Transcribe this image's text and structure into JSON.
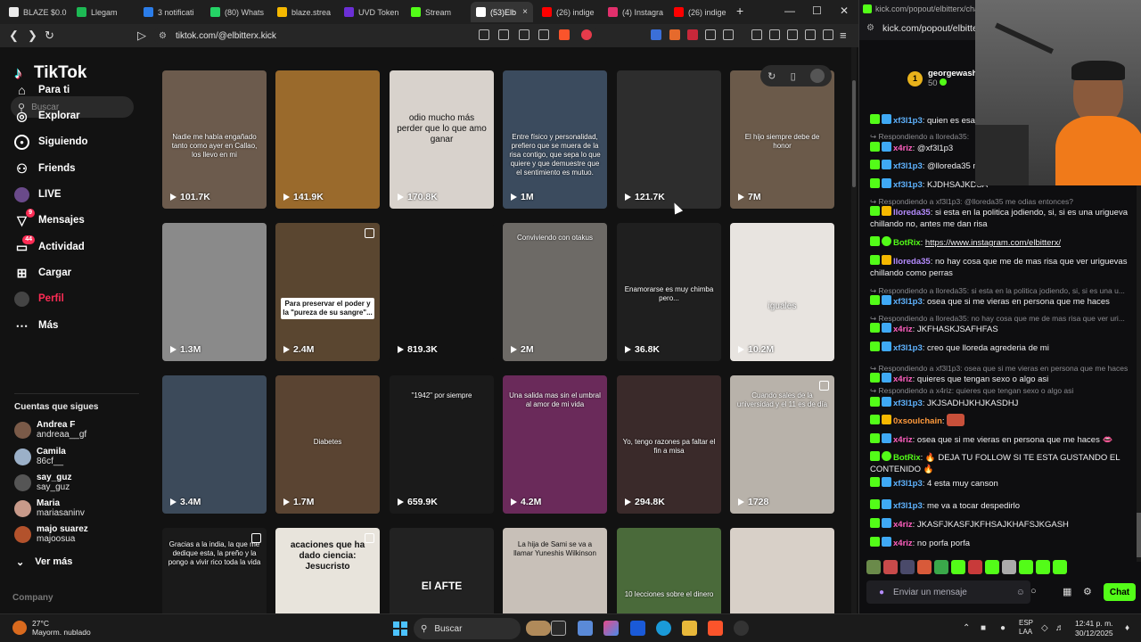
{
  "browser": {
    "tabs": [
      {
        "label": "BLAZE $0.0",
        "color": "#eaeaea"
      },
      {
        "label": "Llegam",
        "color": "#1db954"
      },
      {
        "label": "3 notificati",
        "color": "#2b7de9"
      },
      {
        "label": "(80) Whats",
        "color": "#25d366"
      },
      {
        "label": "blaze.strea",
        "color": "#f5b800"
      },
      {
        "label": "UVD Token",
        "color": "#6b2fd6"
      },
      {
        "label": "Stream",
        "color": "#53fc18"
      },
      {
        "label": "(53)Elb",
        "color": "#ffffff"
      },
      {
        "label": "(26) indige",
        "color": "#ff0000"
      },
      {
        "label": "(4) Instagra",
        "color": "#e1306c"
      },
      {
        "label": "(26) indige",
        "color": "#ff0000"
      }
    ],
    "url": "tiktok.com/@elbitterx.kick",
    "new_tab": "+",
    "close_tab": "×"
  },
  "tiktok": {
    "logo": "TikTok",
    "search_placeholder": "Buscar",
    "nav": [
      {
        "label": "Para ti",
        "icon": "home-icon"
      },
      {
        "label": "Explorar",
        "icon": "compass-icon"
      },
      {
        "label": "Siguiendo",
        "icon": "following-icon"
      },
      {
        "label": "Friends",
        "icon": "friends-icon"
      },
      {
        "label": "LIVE",
        "icon": "live-icon"
      },
      {
        "label": "Mensajes",
        "icon": "messages-icon",
        "badge": "9"
      },
      {
        "label": "Actividad",
        "icon": "activity-icon",
        "badge": "44"
      },
      {
        "label": "Cargar",
        "icon": "upload-icon"
      },
      {
        "label": "Perfil",
        "icon": "profile-icon"
      },
      {
        "label": "Más",
        "icon": "more-icon"
      }
    ],
    "following_header": "Cuentas que sigues",
    "following": [
      {
        "name": "Andrea F",
        "handle": "andreaa__gf",
        "color": "#7a5a48"
      },
      {
        "name": "Camila",
        "handle": "86cf__",
        "color": "#9bb0c8"
      },
      {
        "name": "say_guz",
        "handle": "say_guz",
        "color": "#555"
      },
      {
        "name": "Maria",
        "handle": "mariasaninv",
        "color": "#c89a8a"
      },
      {
        "name": "majo suarez",
        "handle": "majoosua",
        "color": "#b3522c"
      }
    ],
    "see_more": "Ver más",
    "company": "Company",
    "videos": [
      {
        "views": "101.7K",
        "caption": "Nadie me había engañado tanto como ayer en Callao, los llevo en mi",
        "bg": "#6c5b4d"
      },
      {
        "views": "141.9K",
        "caption": "",
        "bg": "#9a6a2c"
      },
      {
        "views": "170.8K",
        "caption": "odio mucho más perder que lo que amo ganar",
        "bg": "#d8d2cc"
      },
      {
        "views": "1M",
        "caption": "Entre físico y personalidad, prefiero que se muera de la risa contigo, que sepa lo que quiere y que demuestre que el sentimiento es mutuo.",
        "bg": "#3b4b5e"
      },
      {
        "views": "121.7K",
        "caption": "",
        "bg": "#2d2d2d"
      },
      {
        "views": "7M",
        "caption": "El hijo siempre debe de honor",
        "bg": "#6b5a4a"
      },
      {
        "views": "1.3M",
        "caption": "",
        "bg": "#8a8a8a"
      },
      {
        "views": "2.4M",
        "caption": "Para preservar el poder y la \"pureza de su sangre\"...",
        "bg": "#5a4630"
      },
      {
        "views": "819.3K",
        "caption": "",
        "bg": "#121212"
      },
      {
        "views": "2M",
        "caption": "Conviviendo con otakus",
        "bg": "#6d6a66"
      },
      {
        "views": "36.8K",
        "caption": "Enamorarse es muy chimba pero...",
        "bg": "#1f1f1f"
      },
      {
        "views": "10.2M",
        "caption": "iguales",
        "bg": "#e8e4e0"
      },
      {
        "views": "3.4M",
        "caption": "",
        "bg": "#3c4a5a"
      },
      {
        "views": "1.7M",
        "caption": "Diabetes",
        "bg": "#5a4432"
      },
      {
        "views": "659.9K",
        "caption": "\"1942\" por siempre",
        "bg": "#1a1a1a"
      },
      {
        "views": "4.2M",
        "caption": "Una salida mas sin el umbral al amor de mi vida",
        "bg": "#6a2a5a"
      },
      {
        "views": "294.8K",
        "caption": "Yo, tengo razones pa faltar el fin a misa",
        "bg": "#3a2a2a"
      },
      {
        "views": "1728",
        "caption": "Cuando sales de la universidad y el 11 es de día",
        "bg": "#b8b2aa"
      },
      {
        "views": "",
        "caption": "Gracias a la india, la que me dedique esta, la preño y la pongo a vivir rico toda la vida",
        "bg": "#1a1a1a"
      },
      {
        "views": "",
        "caption": "acaciones que ha dado ciencia: Jesucristo",
        "bg": "#e8e4dc"
      },
      {
        "views": "",
        "caption": "El AFTE",
        "bg": "#222"
      },
      {
        "views": "",
        "caption": "La hija de Sami se va a llamar Yuneshis Wilkinson",
        "bg": "#c8c0b8"
      },
      {
        "views": "",
        "caption": "10 lecciones sobre el dinero",
        "bg": "#4a6a3a"
      },
      {
        "views": "",
        "caption": "",
        "bg": "#d8d0c8"
      }
    ]
  },
  "chat": {
    "url_top": "kick.com/popout/elbitterx/chat",
    "url": "kick.com/popout/elbitten",
    "leader": {
      "name": "georgewash",
      "rank": "1",
      "points": "50"
    },
    "messages": [
      {
        "type": "msg",
        "user": "xf3l1p3",
        "ucolor": "#5fb3ff",
        "badge": "mod",
        "text": ": quien es esa beb"
      },
      {
        "type": "reply",
        "text": "Respondiendo a lloreda35:"
      },
      {
        "type": "msg",
        "user": "x4riz",
        "ucolor": "#ff5fbf",
        "badge": "mod",
        "text": ": @xf3l1p3"
      },
      {
        "type": "msg",
        "user": "xf3l1p3",
        "ucolor": "#5fb3ff",
        "badge": "mod",
        "text": ": @lloreda35 me o"
      },
      {
        "type": "msg",
        "user": "xf3l1p3",
        "ucolor": "#5fb3ff",
        "badge": "mod",
        "text": ": KJDHSAJKDSA"
      },
      {
        "type": "reply",
        "text": "Respondiendo a xf3l1p3: @lloreda35 me odias entonces?"
      },
      {
        "type": "msg",
        "user": "lloreda35",
        "ucolor": "#b58cff",
        "badge": "crown",
        "text": ": si esta en la politica jodiendo, si, si es una urigueva chillando no, antes me dan risa"
      },
      {
        "type": "msg",
        "user": "BotRix",
        "ucolor": "#53fc18",
        "badge": "verif",
        "text": ": ",
        "link": "https://www.instagram.com/elbitterx/"
      },
      {
        "type": "msg",
        "user": "lloreda35",
        "ucolor": "#b58cff",
        "badge": "crown",
        "text": ": no hay cosa que me de mas risa que ver uriguevas chillando como perras"
      },
      {
        "type": "reply",
        "text": "Respondiendo a lloreda35: si esta en la politica jodiendo, si, si es una u..."
      },
      {
        "type": "msg",
        "user": "xf3l1p3",
        "ucolor": "#5fb3ff",
        "badge": "mod",
        "text": ": osea que si me vieras en persona que me haces"
      },
      {
        "type": "reply",
        "text": "Respondiendo a lloreda35: no hay cosa que me de mas risa que ver uri..."
      },
      {
        "type": "msg",
        "user": "x4riz",
        "ucolor": "#ff5fbf",
        "badge": "mod",
        "text": ": JKFHASKJSAFHFAS"
      },
      {
        "type": "msg",
        "user": "xf3l1p3",
        "ucolor": "#5fb3ff",
        "badge": "mod",
        "text": ": creo que lloreda agrederia de mi"
      },
      {
        "type": "reply",
        "text": "Respondiendo a xf3l1p3: osea que si me vieras en persona que me haces"
      },
      {
        "type": "msg",
        "user": "x4riz",
        "ucolor": "#ff5fbf",
        "badge": "mod",
        "text": ": quieres que tengan sexo o algo asi"
      },
      {
        "type": "reply",
        "text": "Respondiendo a x4riz: quieres que tengan sexo o algo asi"
      },
      {
        "type": "msg",
        "user": "xf3l1p3",
        "ucolor": "#5fb3ff",
        "badge": "mod",
        "text": ": JKJSADHJKHJKASDHJ"
      },
      {
        "type": "msg",
        "user": "0xsoulchain",
        "ucolor": "#ff9a3c",
        "badge": "crown",
        "text": ": ",
        "emote": true
      },
      {
        "type": "msg",
        "user": "x4riz",
        "ucolor": "#ff5fbf",
        "badge": "mod",
        "text": ": osea que si me vieras en persona que me haces 👄"
      },
      {
        "type": "msg",
        "user": "BotRix",
        "ucolor": "#53fc18",
        "badge": "verif",
        "text": ": 🔥 DEJA TU FOLLOW SI TE ESTA GUSTANDO EL CONTENIDO 🔥"
      },
      {
        "type": "msg",
        "user": "xf3l1p3",
        "ucolor": "#5fb3ff",
        "badge": "mod",
        "text": ": 4 esta muy canson"
      },
      {
        "type": "msg",
        "user": "xf3l1p3",
        "ucolor": "#5fb3ff",
        "badge": "mod",
        "text": ": me va a tocar despedirlo"
      },
      {
        "type": "msg",
        "user": "x4riz",
        "ucolor": "#ff5fbf",
        "badge": "mod",
        "text": ": JKASFJKASFJKFHSAJKHAFSJKGASH"
      },
      {
        "type": "msg",
        "user": "x4riz",
        "ucolor": "#ff5fbf",
        "badge": "mod",
        "text": ": no porfa porfa"
      }
    ],
    "input_placeholder": "Enviar un mensaje",
    "send_label": "Chat",
    "emote_colors": [
      "#6a8a4a",
      "#c84a4a",
      "#4a4a6a",
      "#d85a3a",
      "#3aa84a",
      "#53fc18",
      "#c83a3a",
      "#53fc18",
      "#aaa",
      "#53fc18",
      "#53fc18",
      "#53fc18"
    ]
  },
  "taskbar": {
    "temp": "27°C",
    "weather": "Mayorm. nublado",
    "search": "Buscar",
    "lang1": "ESP",
    "lang2": "LAA",
    "time": "12:41 p. m.",
    "date": "30/12/2025"
  }
}
